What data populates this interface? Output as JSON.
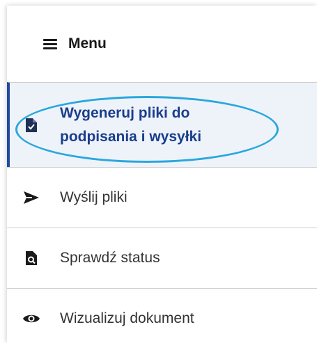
{
  "menu": {
    "title": "Menu"
  },
  "items": [
    {
      "label_line1": "Wygeneruj pliki do",
      "label_line2": "podpisania i wysyłki",
      "icon": "file-check-icon",
      "active": true
    },
    {
      "label": "Wyślij pliki",
      "icon": "send-icon",
      "active": false
    },
    {
      "label": "Sprawdź status",
      "icon": "document-search-icon",
      "active": false
    },
    {
      "label": "Wizualizuj dokument",
      "icon": "eye-icon",
      "active": false
    }
  ],
  "colors": {
    "accent": "#1f4aa0",
    "active_text": "#1a3e8c",
    "active_bg": "#eef3fa",
    "highlight": "#2aa7dd"
  }
}
